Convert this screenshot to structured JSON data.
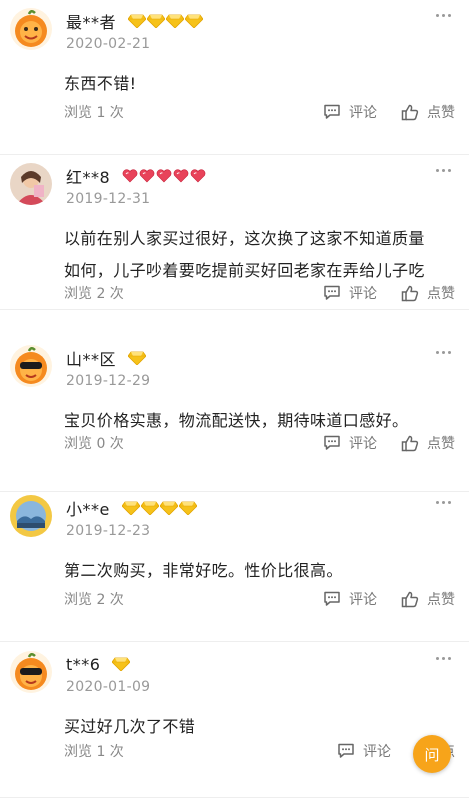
{
  "reviews": [
    {
      "username": "最**者",
      "badge_icon": "gold-diamond-icon",
      "badge_count": 4,
      "avatar": "orange-face-avatar",
      "date": "2020-02-21",
      "text_lines": [
        "东西不错!"
      ],
      "views": "浏览 1 次",
      "comment_label": "评论",
      "like_label": "点赞"
    },
    {
      "username": "红**8",
      "badge_icon": "red-heart-icon",
      "badge_count": 5,
      "avatar": "photo-avatar",
      "date": "2019-12-31",
      "text_lines": [
        "以前在别人家买过很好，这次换了这家不知道质量",
        "如何，儿子吵着要吃提前买好回老家在弄给儿子吃"
      ],
      "views": "浏览 2 次",
      "comment_label": "评论",
      "like_label": "点赞"
    },
    {
      "username": "山**区",
      "badge_icon": "gold-diamond-icon",
      "badge_count": 1,
      "avatar": "orange-sunglasses-avatar",
      "date": "2019-12-29",
      "text_lines": [
        "宝贝价格实惠，物流配送快，期待味道口感好。"
      ],
      "views": "浏览 0 次",
      "comment_label": "评论",
      "like_label": "点赞"
    },
    {
      "username": "小**e",
      "badge_icon": "gold-diamond-icon",
      "badge_count": 4,
      "avatar": "landscape-avatar",
      "date": "2019-12-23",
      "text_lines": [
        "第二次购买，非常好吃。性价比很高。"
      ],
      "views": "浏览 2 次",
      "comment_label": "评论",
      "like_label": "点赞"
    },
    {
      "username": "t**6",
      "badge_icon": "gold-diamond-icon",
      "badge_count": 1,
      "avatar": "orange-sunglasses-avatar",
      "date": "2020-01-09",
      "text_lines": [
        "买过好几次了不错"
      ],
      "views": "浏览 1 次",
      "comment_label": "评论",
      "like_label": "点"
    }
  ],
  "floating_button": {
    "label": "问",
    "icon": "ask-question-icon"
  },
  "colors": {
    "accent": "#f7a41a",
    "gold": "#f5c518",
    "heart": "#e8435a",
    "muted_text": "#999999"
  }
}
